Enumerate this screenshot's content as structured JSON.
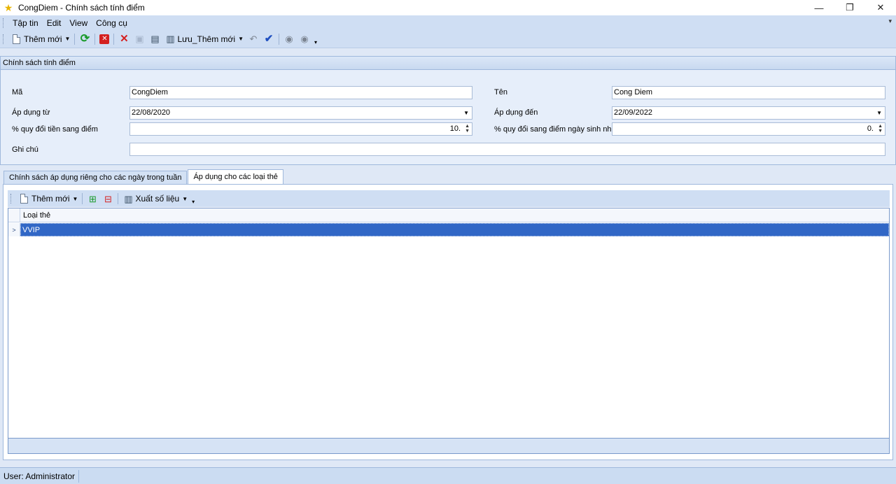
{
  "window": {
    "title": "CongDiem - Chính sách tính điểm",
    "minimize": "—",
    "restore": "❐",
    "close": "✕"
  },
  "menu": {
    "items": [
      "Tập tin",
      "Edit",
      "View",
      "Công cụ"
    ],
    "overflow": "▾"
  },
  "toolbar": {
    "new_label": "Thêm mới",
    "save_new_label": "Lưu_Thêm mới"
  },
  "group": {
    "header": "Chính sách tính điểm",
    "ma_label": "Mã",
    "ma_value": "CongDiem",
    "ten_label": "Tên",
    "ten_value": "Cong Diem",
    "ap_dung_tu_label": "Áp dụng từ",
    "ap_dung_tu_value": "22/08/2020",
    "ap_dung_den_label": "Áp dụng đến",
    "ap_dung_den_value": "22/09/2022",
    "quy_doi_tien_label": "% quy đổi tiền sang điểm",
    "quy_doi_tien_value": "10.",
    "quy_doi_sinh_nhat_label": "% quy đổi sang điểm ngày sinh nhật",
    "quy_doi_sinh_nhat_value": "0.",
    "ghi_chu_label": "Ghi chú",
    "ghi_chu_value": ""
  },
  "tabs": {
    "tab1": "Chính sách áp dụng riêng cho các ngày trong tuần",
    "tab2": "Áp dụng cho các loại thẻ"
  },
  "inner_toolbar": {
    "new_label": "Thêm mới",
    "export_label": "Xuất số liệu"
  },
  "grid": {
    "column": "Loại thẻ",
    "rows": [
      {
        "value": "VVIP"
      }
    ]
  },
  "status": {
    "user": "User: Administrator"
  }
}
